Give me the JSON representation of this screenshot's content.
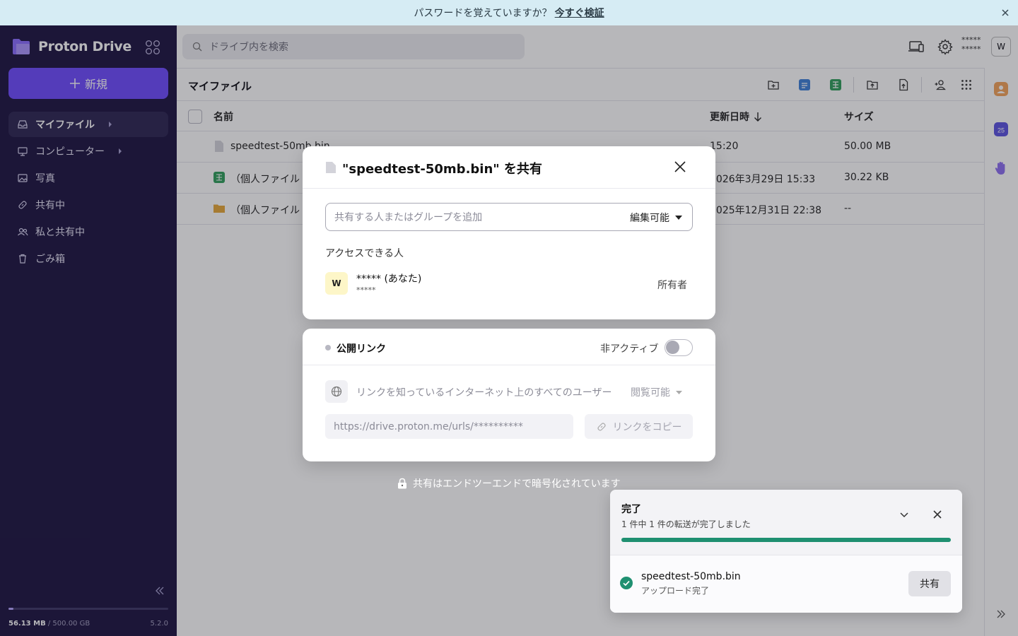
{
  "banner": {
    "text": "パスワードを覚えていますか？",
    "link": "今すぐ検証"
  },
  "sidebar": {
    "app_name": "Proton Drive",
    "new_label": "新規",
    "items": [
      {
        "label": "マイファイル",
        "icon": "inbox-icon",
        "active": true,
        "has_caret": true
      },
      {
        "label": "コンピューター",
        "icon": "monitor-icon",
        "active": false,
        "has_caret": true
      },
      {
        "label": "写真",
        "icon": "image-icon",
        "active": false
      },
      {
        "label": "共有中",
        "icon": "link-icon",
        "active": false
      },
      {
        "label": "私と共有中",
        "icon": "users-icon",
        "active": false
      },
      {
        "label": "ごみ箱",
        "icon": "trash-icon",
        "active": false
      }
    ],
    "storage_used": "56.13 MB",
    "storage_total": "/ 500.00 GB",
    "storage_fraction": 0.03,
    "version": "5.2.0"
  },
  "header": {
    "search_placeholder": "ドライブ内を検索",
    "user_name": "*****",
    "user_email": "*****",
    "avatar_initial": "W"
  },
  "main": {
    "title": "マイファイル",
    "columns": {
      "name": "名前",
      "modified": "更新日時",
      "size": "サイズ"
    },
    "rows": [
      {
        "name": "speedtest-50mb.bin",
        "modified": "15:20",
        "size": "50.00 MB",
        "icon": "file-icon"
      },
      {
        "name": "（個人ファイル",
        "modified": "2026年3月29日 15:33",
        "size": "30.22 KB",
        "icon": "sheet-icon"
      },
      {
        "name": "（個人ファイル",
        "modified": "2025年12月31日 22:38",
        "size": "--",
        "icon": "folder-icon"
      }
    ]
  },
  "share_dialog": {
    "title": "\"speedtest-50mb.bin\" を共有",
    "input_placeholder": "共有する人またはグループを追加",
    "permission": "編集可能",
    "access_label": "アクセスできる人",
    "owner": {
      "initial": "W",
      "name": "***** (あなた)",
      "email": "*****",
      "role": "所有者"
    }
  },
  "public_link": {
    "title": "公開リンク",
    "status": "非アクティブ",
    "enabled": false,
    "audience": "リンクを知っているインターネット上のすべてのユーザー",
    "permission": "閲覧可能",
    "url": "https://drive.proton.me/urls/**********",
    "copy_label": "リンクをコピー"
  },
  "e2e_note": "共有はエンドツーエンドで暗号化されています",
  "transfer": {
    "title": "完了",
    "subtitle": "1 件中 1 件の転送が完了しました",
    "progress": 1.0,
    "item_name": "speedtest-50mb.bin",
    "item_status": "アップロード完了",
    "share_label": "共有"
  },
  "colors": {
    "sidebar_bg": "#1b1340",
    "brand": "#6d4aff",
    "banner_bg": "#d6ecf4",
    "progress": "#1f9071"
  }
}
